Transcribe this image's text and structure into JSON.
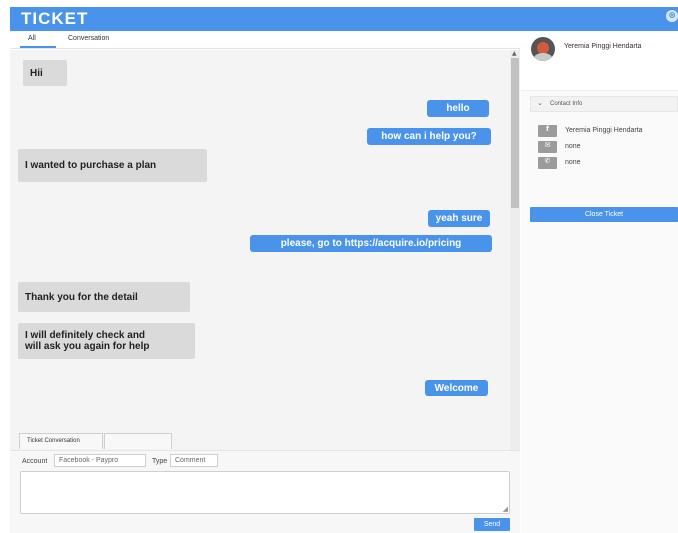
{
  "header": {
    "title": "TICKET",
    "close_glyph": "⊗"
  },
  "tabs": [
    {
      "label": "All"
    },
    {
      "label": "Conversation"
    }
  ],
  "messages": [
    {
      "side": "in",
      "text": "Hii"
    },
    {
      "side": "out",
      "text": "hello"
    },
    {
      "side": "out",
      "text": "how can i help you?"
    },
    {
      "side": "in",
      "text": "I wanted to purchase a plan"
    },
    {
      "side": "out",
      "text": "yeah sure"
    },
    {
      "side": "out",
      "text": "please, go to https://acquire.io/pricing"
    },
    {
      "side": "in",
      "text": "Thank you for the detail"
    },
    {
      "side": "in",
      "text": "I will definitely check and\nwill ask you again for help"
    },
    {
      "side": "out",
      "text": "Welcome"
    }
  ],
  "ticket_tabs": [
    {
      "label": "Ticket Conversation"
    },
    {
      "label": ""
    }
  ],
  "compose": {
    "account_label": "Account",
    "account_value": "Facebook - Paypro",
    "type_label": "Type",
    "type_value": "Comment",
    "message_value": "",
    "send_label": "Send"
  },
  "contact": {
    "name": "Yeremia Pinggi Hendarta",
    "section_title": "Contact Info",
    "rows": [
      {
        "icon": "facebook-icon",
        "glyph": "f",
        "text": "Yeremia Pinggi Hendarta"
      },
      {
        "icon": "email-icon",
        "glyph": "✉",
        "text": "none"
      },
      {
        "icon": "phone-icon",
        "glyph": "✆",
        "text": "none"
      }
    ],
    "close_ticket_label": "Close Ticket"
  },
  "colors": {
    "accent": "#4a93ea",
    "incoming_bubble": "#dadada",
    "chat_bg": "#f4f4f4"
  }
}
